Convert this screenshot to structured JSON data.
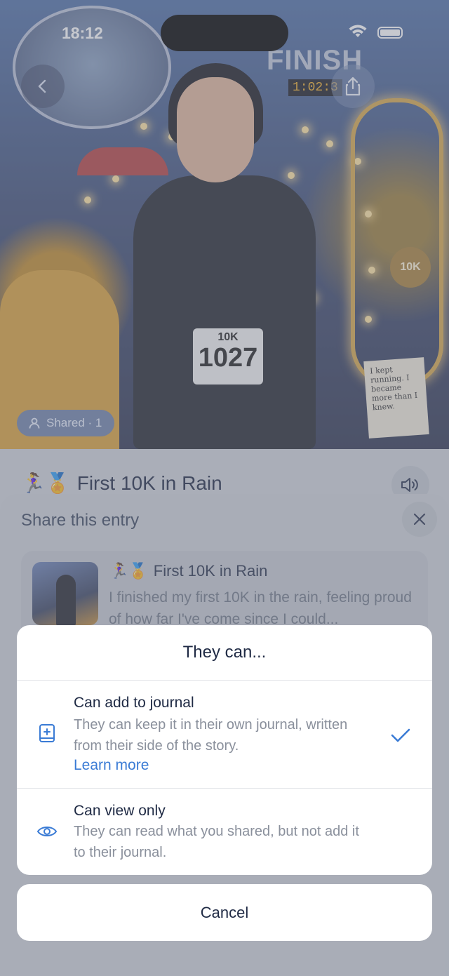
{
  "status_bar": {
    "time": "18:12"
  },
  "hero": {
    "finish_sign": "FINISH",
    "race_clock": "1:02:3",
    "bib_distance": "10K",
    "bib_number": "1027",
    "medal_text": "10K",
    "note_text": "I kept running. I became more than I knew.",
    "shared_label": "Shared · 1"
  },
  "entry": {
    "emojis": "🏃‍♀️🏅",
    "title": "First 10K in Rain"
  },
  "share_sheet": {
    "title": "Share this entry",
    "preview": {
      "emojis": "🏃‍♀️🏅",
      "title": "First 10K in Rain",
      "body": "I finished my first 10K in the rain, feeling proud of how far I've come since I could..."
    }
  },
  "permission_sheet": {
    "heading": "They can...",
    "options": [
      {
        "title": "Can add to journal",
        "description": "They can keep it in their own journal, written from their side of the story.",
        "link": "Learn more",
        "selected": true,
        "icon": "journal-add-icon"
      },
      {
        "title": "Can view only",
        "description": "They can read what you shared, but not add it to their journal.",
        "selected": false,
        "icon": "eye-icon"
      }
    ],
    "cancel_label": "Cancel"
  },
  "colors": {
    "accent": "#3a7bd5",
    "text": "#1f2a44",
    "muted": "#8a909c"
  }
}
